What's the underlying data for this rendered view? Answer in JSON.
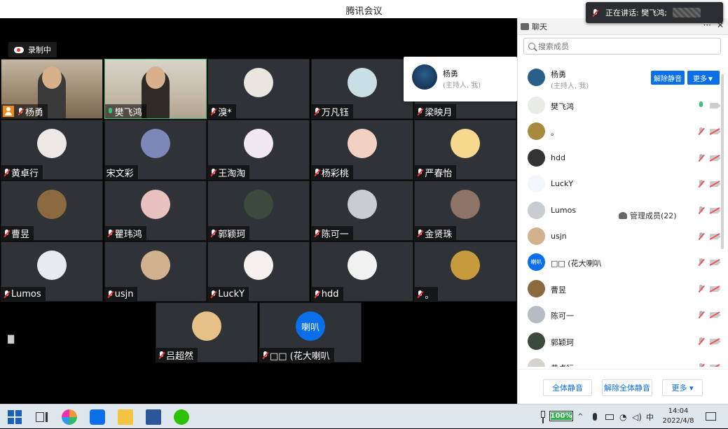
{
  "window": {
    "title": "腾讯会议"
  },
  "toast": {
    "text": "正在讲话: 樊飞鸿;"
  },
  "recording": {
    "label": "录制中"
  },
  "host_popup": {
    "name": "杨勇",
    "role": "(主持人, 我)"
  },
  "tiles": [
    {
      "name": "杨勇",
      "type": "cam",
      "host": true,
      "mic": "off"
    },
    {
      "name": "樊飞鸿",
      "type": "cam2",
      "host": false,
      "mic": "on"
    },
    {
      "name": "溴*",
      "avatar": "#e9e6df",
      "mic": "off"
    },
    {
      "name": "万凡钰",
      "avatar": "#c9dfe6",
      "mic": "off"
    },
    {
      "name": "梁映月",
      "avatar": "#2a5e8c",
      "mic": "off"
    },
    {
      "name": "黄卓行",
      "avatar": "#ece8e6",
      "mic": "off"
    },
    {
      "name": "宋文彩",
      "avatar": "#7d87b8",
      "mic": "none"
    },
    {
      "name": "王淘淘",
      "avatar": "#f1e9ef",
      "mic": "off"
    },
    {
      "name": "杨彩桃",
      "avatar": "#f3d2c4",
      "mic": "off"
    },
    {
      "name": "严春怡",
      "avatar": "#f6d98f",
      "mic": "off"
    },
    {
      "name": "曹昱",
      "avatar": "#8b6a3f",
      "mic": "off"
    },
    {
      "name": "瞿玮鸿",
      "avatar": "#e9c1bf",
      "mic": "off"
    },
    {
      "name": "郭颖珂",
      "avatar": "#3b4a3c",
      "mic": "off"
    },
    {
      "name": "陈可一",
      "avatar": "#c7cdd3",
      "mic": "off"
    },
    {
      "name": "金贤珠",
      "avatar": "#8d7466",
      "mic": "off"
    },
    {
      "name": "Lumos",
      "avatar": "#e8ebee",
      "mic": "off"
    },
    {
      "name": "usjn",
      "avatar": "#d1b18e",
      "mic": "off"
    },
    {
      "name": "LuckY",
      "avatar": "#f5f1ee",
      "mic": "off"
    },
    {
      "name": "hdd",
      "avatar": "#f2f2f2",
      "mic": "off"
    },
    {
      "name": "。",
      "avatar": "#c89a3e",
      "mic": "off"
    },
    {
      "name": "吕超然",
      "avatar": "#e7c188",
      "mic": "off"
    },
    {
      "name": "□□ (花大喇叭",
      "avatar": "#0a6fe8",
      "avatar_text": "喇叭",
      "mic": "off"
    }
  ],
  "panel": {
    "tab_chat": "聊天",
    "tab_members": "管理成员(22)",
    "more_dots": "···",
    "close": "✕",
    "search_placeholder": "搜索成员",
    "host_role": "(主持人, 我)",
    "btn_unmute": "解除静音",
    "btn_more": "更多▼",
    "members": [
      {
        "name": "杨勇",
        "avatar": "#2a5e8c",
        "host": true
      },
      {
        "name": "樊飞鸿",
        "avatar": "#e9ece6",
        "mic": "on"
      },
      {
        "name": "。",
        "avatar": "#a88a3e",
        "mic": "off"
      },
      {
        "name": "hdd",
        "avatar": "#333333",
        "mic": "off"
      },
      {
        "name": "LuckY",
        "avatar": "#f3f6fb",
        "mic": "off"
      },
      {
        "name": "Lumos",
        "avatar": "#c9ccd0",
        "mic": "off"
      },
      {
        "name": "usjn",
        "avatar": "#d1b18e",
        "mic": "off"
      },
      {
        "name": "□□ (花大喇叭",
        "avatar": "#0a6fe8",
        "avatar_text": "喇叭",
        "mic": "off"
      },
      {
        "name": "曹昱",
        "avatar": "#8b6a3f",
        "mic": "off"
      },
      {
        "name": "陈可一",
        "avatar": "#b5bcc3",
        "mic": "off"
      },
      {
        "name": "郭颖珂",
        "avatar": "#3b4a3c",
        "mic": "off"
      },
      {
        "name": "黄卓行",
        "avatar": "#d6d2ce",
        "mic": "off"
      }
    ],
    "bottom": {
      "mute_all": "全体静音",
      "unmute_all": "解除全体静音",
      "more": "更多 ▾"
    }
  },
  "taskbar": {
    "battery": "100%",
    "battery_level": 1.0,
    "ime": "中",
    "time": "14:04",
    "date": "2022/4/8"
  }
}
